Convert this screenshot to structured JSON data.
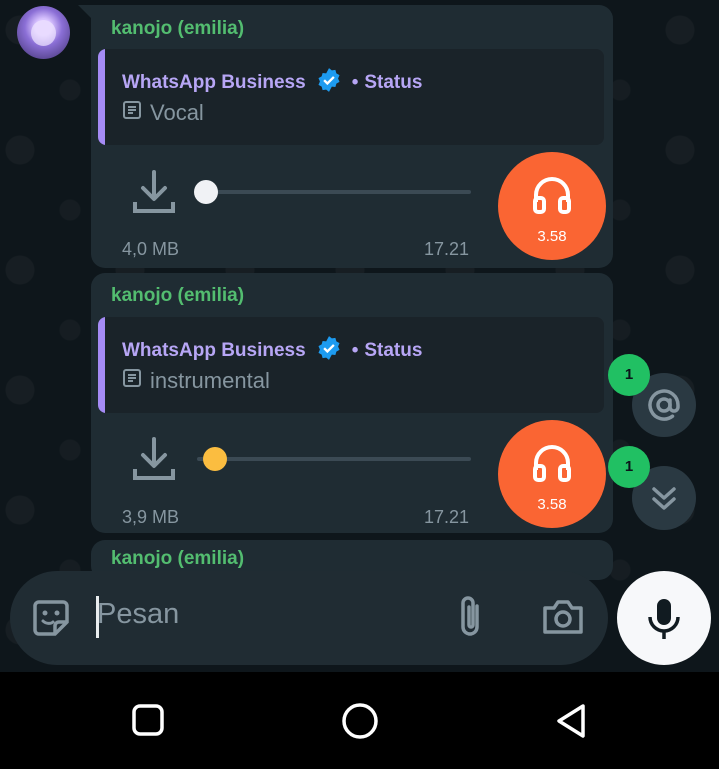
{
  "messages": [
    {
      "sender": "kanojo (emilia)",
      "quote_title": "WhatsApp Business",
      "quote_status": "Status",
      "quote_caption": "Vocal",
      "file_size": "4,0 MB",
      "time": "17.21",
      "duration": "3.58",
      "progress": 0.0
    },
    {
      "sender": "kanojo (emilia)",
      "quote_title": "WhatsApp Business",
      "quote_status": "Status",
      "quote_caption": "instrumental",
      "file_size": "3,9 MB",
      "time": "17.21",
      "duration": "3.58",
      "progress": 0.0
    },
    {
      "sender": "kanojo (emilia)"
    }
  ],
  "fabs": {
    "mentions_count": "1",
    "unread_count": "1"
  },
  "composer": {
    "placeholder": "Pesan"
  },
  "colors": {
    "accent_green": "#53bd70",
    "headphone_orange": "#fa6533",
    "verified_blue": "#1d9bf0",
    "quote_purple": "#a58bf5"
  },
  "icons": [
    "sticker-emoji-icon",
    "paperclip-icon",
    "camera-icon",
    "mic-icon",
    "headphones-icon",
    "download-icon",
    "verified-badge-icon",
    "document-icon",
    "at-mention-icon",
    "double-chevron-down-icon",
    "nav-recents-icon",
    "nav-home-icon",
    "nav-back-icon"
  ]
}
